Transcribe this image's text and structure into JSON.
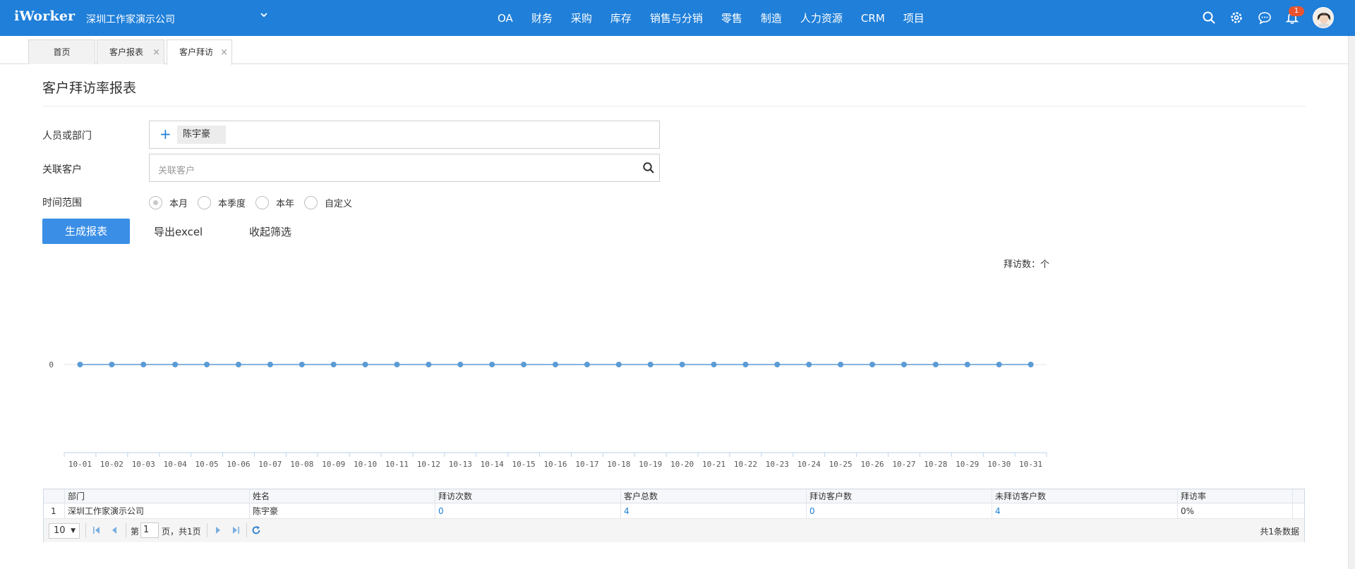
{
  "app": {
    "logo": "iWorker",
    "company": "深圳工作家演示公司"
  },
  "nav": [
    "OA",
    "财务",
    "采购",
    "库存",
    "销售与分销",
    "零售",
    "制造",
    "人力资源",
    "CRM",
    "项目"
  ],
  "notifications": {
    "count": "1"
  },
  "tabs": [
    {
      "label": "首页",
      "closable": false
    },
    {
      "label": "客户报表",
      "closable": true
    },
    {
      "label": "客户拜访",
      "closable": true,
      "active": true
    }
  ],
  "page": {
    "title": "客户拜访率报表"
  },
  "filters": {
    "person_label": "人员或部门",
    "person_chip": "陈宇豪",
    "customer_label": "关联客户",
    "customer_placeholder": "关联客户",
    "time_label": "时间范围",
    "time_options": [
      "本月",
      "本季度",
      "本年",
      "自定义"
    ],
    "time_selected": "本月"
  },
  "actions": {
    "generate": "生成报表",
    "export": "导出excel",
    "collapse": "收起筛选"
  },
  "chart_unit": "拜访数：个",
  "chart_data": {
    "type": "line",
    "x": [
      "10-01",
      "10-02",
      "10-03",
      "10-04",
      "10-05",
      "10-06",
      "10-07",
      "10-08",
      "10-09",
      "10-10",
      "10-11",
      "10-12",
      "10-13",
      "10-14",
      "10-15",
      "10-16",
      "10-17",
      "10-18",
      "10-19",
      "10-20",
      "10-21",
      "10-22",
      "10-23",
      "10-24",
      "10-25",
      "10-26",
      "10-27",
      "10-28",
      "10-29",
      "10-30",
      "10-31"
    ],
    "series": [
      {
        "values": [
          0,
          0,
          0,
          0,
          0,
          0,
          0,
          0,
          0,
          0,
          0,
          0,
          0,
          0,
          0,
          0,
          0,
          0,
          0,
          0,
          0,
          0,
          0,
          0,
          0,
          0,
          0,
          0,
          0,
          0,
          0
        ]
      }
    ],
    "y_ticks": [
      "0"
    ],
    "ylabel": "拜访数：个",
    "color": "#5b9bd5"
  },
  "table": {
    "columns": [
      "部门",
      "姓名",
      "拜访次数",
      "客户总数",
      "拜访客户数",
      "未拜访客户数",
      "拜访率"
    ],
    "rows": [
      {
        "index": "1",
        "cells": [
          "深圳工作家演示公司",
          "陈宇豪",
          "0",
          "4",
          "0",
          "4",
          "0%"
        ]
      }
    ]
  },
  "pager": {
    "page_size": "10",
    "page_prefix": "第",
    "page": "1",
    "page_suffix": "页，共1页",
    "total": "共1条数据"
  }
}
